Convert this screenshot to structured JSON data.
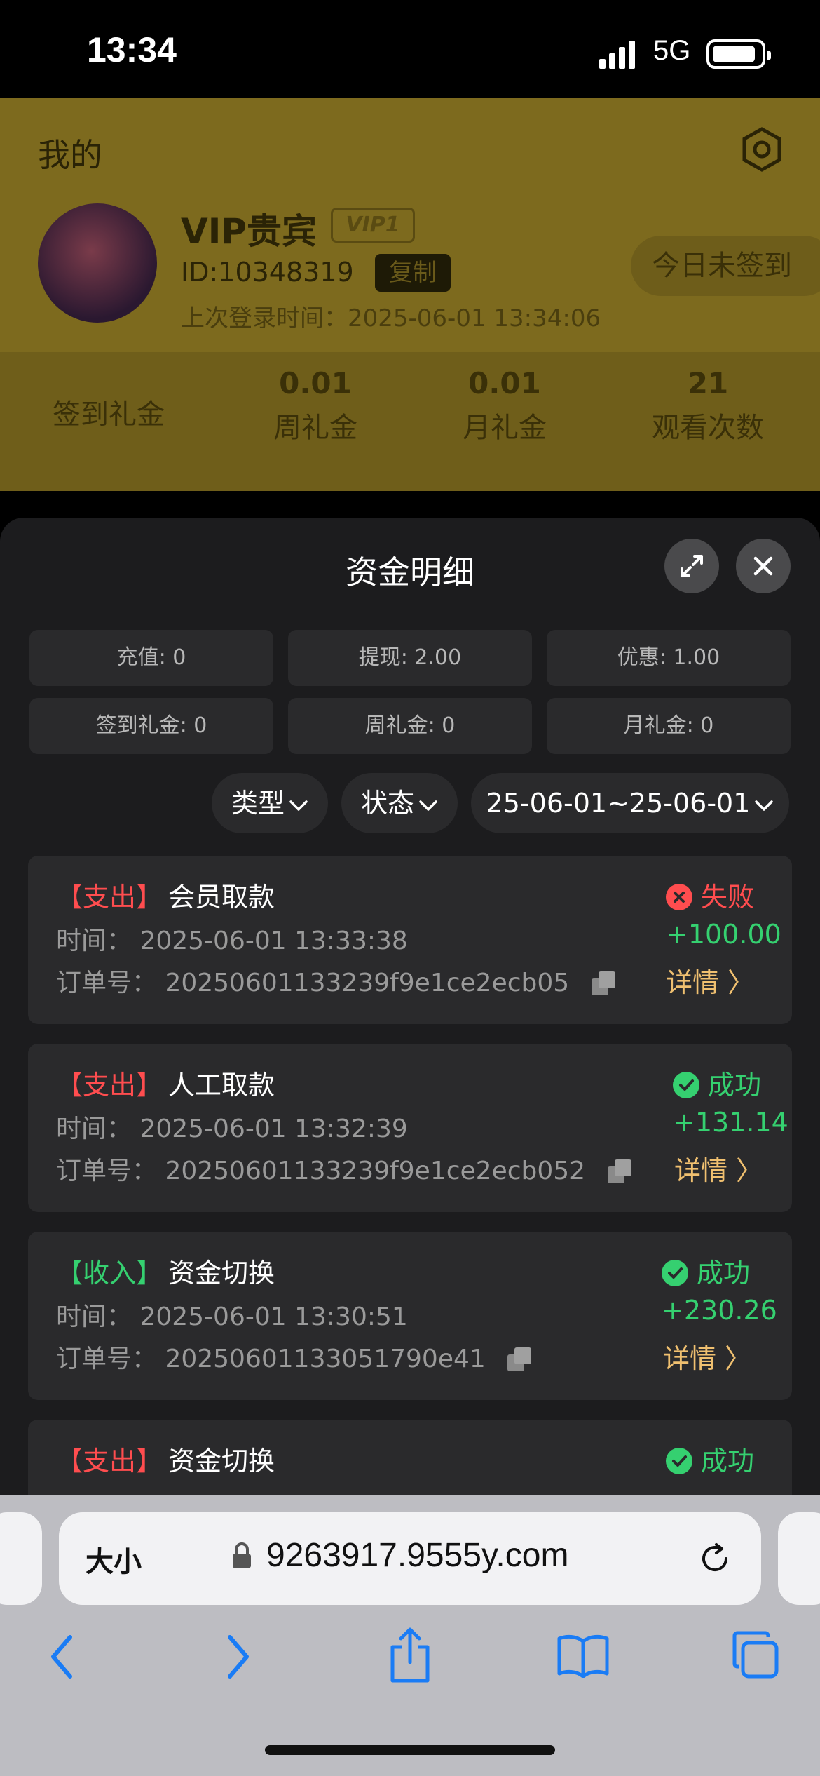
{
  "status_bar": {
    "time": "13:34",
    "network": "5G"
  },
  "background_page": {
    "title": "我的",
    "vip_name": "VIP贵宾",
    "vip_badge": "VIP1",
    "user_id": "ID:10348319",
    "copy_label": "复制",
    "last_login": "上次登录时间：2025-06-01 13:34:06",
    "sign_button": "今日未签到",
    "stats": [
      {
        "value": "",
        "label": "签到礼金"
      },
      {
        "value": "0.01",
        "label": "周礼金"
      },
      {
        "value": "0.01",
        "label": "月礼金"
      },
      {
        "value": "21",
        "label": "观看次数"
      }
    ]
  },
  "sheet": {
    "title": "资金明细",
    "summary": [
      "充值: 0",
      "提现: 2.00",
      "优惠: 1.00",
      "签到礼金: 0",
      "周礼金: 0",
      "月礼金: 0"
    ],
    "filters": {
      "type": "类型",
      "status": "状态",
      "date_range": "25-06-01~25-06-01"
    },
    "records": [
      {
        "type": "【支出】",
        "direction": "out",
        "name": "会员取款",
        "time": "时间：  2025-06-01 13:33:38",
        "order": "订单号：  20250601133239f9e1ce2ecb05",
        "status": "失败",
        "status_kind": "fail",
        "amount": "+100.00",
        "detail": "详情 〉"
      },
      {
        "type": "【支出】",
        "direction": "out",
        "name": "人工取款",
        "time": "时间：  2025-06-01 13:32:39",
        "order": "订单号：  20250601133239f9e1ce2ecb052",
        "status": "成功",
        "status_kind": "ok",
        "amount": "+131.14",
        "detail": "详情 〉"
      },
      {
        "type": "【收入】",
        "direction": "in",
        "name": "资金切换",
        "time": "时间：  2025-06-01 13:30:51",
        "order": "订单号：  20250601133051790e41",
        "status": "成功",
        "status_kind": "ok",
        "amount": "+230.26",
        "detail": "详情 〉"
      },
      {
        "type": "【支出】",
        "direction": "out",
        "name": "资金切换",
        "status": "成功",
        "status_kind": "ok"
      }
    ]
  },
  "browser": {
    "size_label": "大小",
    "url": "9263917.9555y.com"
  }
}
